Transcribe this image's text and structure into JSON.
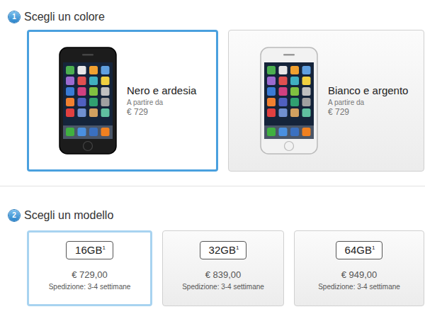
{
  "colors": {
    "number": "1",
    "title": "Scegli un colore",
    "options": [
      {
        "name": "Nero e ardesia",
        "caption": "A partire da",
        "price": "€ 729",
        "selected": true,
        "color": "#1c1c1c"
      },
      {
        "name": "Bianco e argento",
        "caption": "A partire da",
        "price": "€ 729",
        "selected": false,
        "color": "#f2f2f2"
      }
    ]
  },
  "models": {
    "number": "2",
    "title": "Scegli un modello",
    "options": [
      {
        "capacity": "16GB",
        "footnote": "1",
        "price": "€ 729,00",
        "shipping": "Spedizione: 3-4 settimane",
        "selected": true
      },
      {
        "capacity": "32GB",
        "footnote": "1",
        "price": "€ 839,00",
        "shipping": "Spedizione: 3-4 settimane",
        "selected": false
      },
      {
        "capacity": "64GB",
        "footnote": "1",
        "price": "€ 949,00",
        "shipping": "Spedizione: 3-4 settimane",
        "selected": false
      }
    ]
  }
}
